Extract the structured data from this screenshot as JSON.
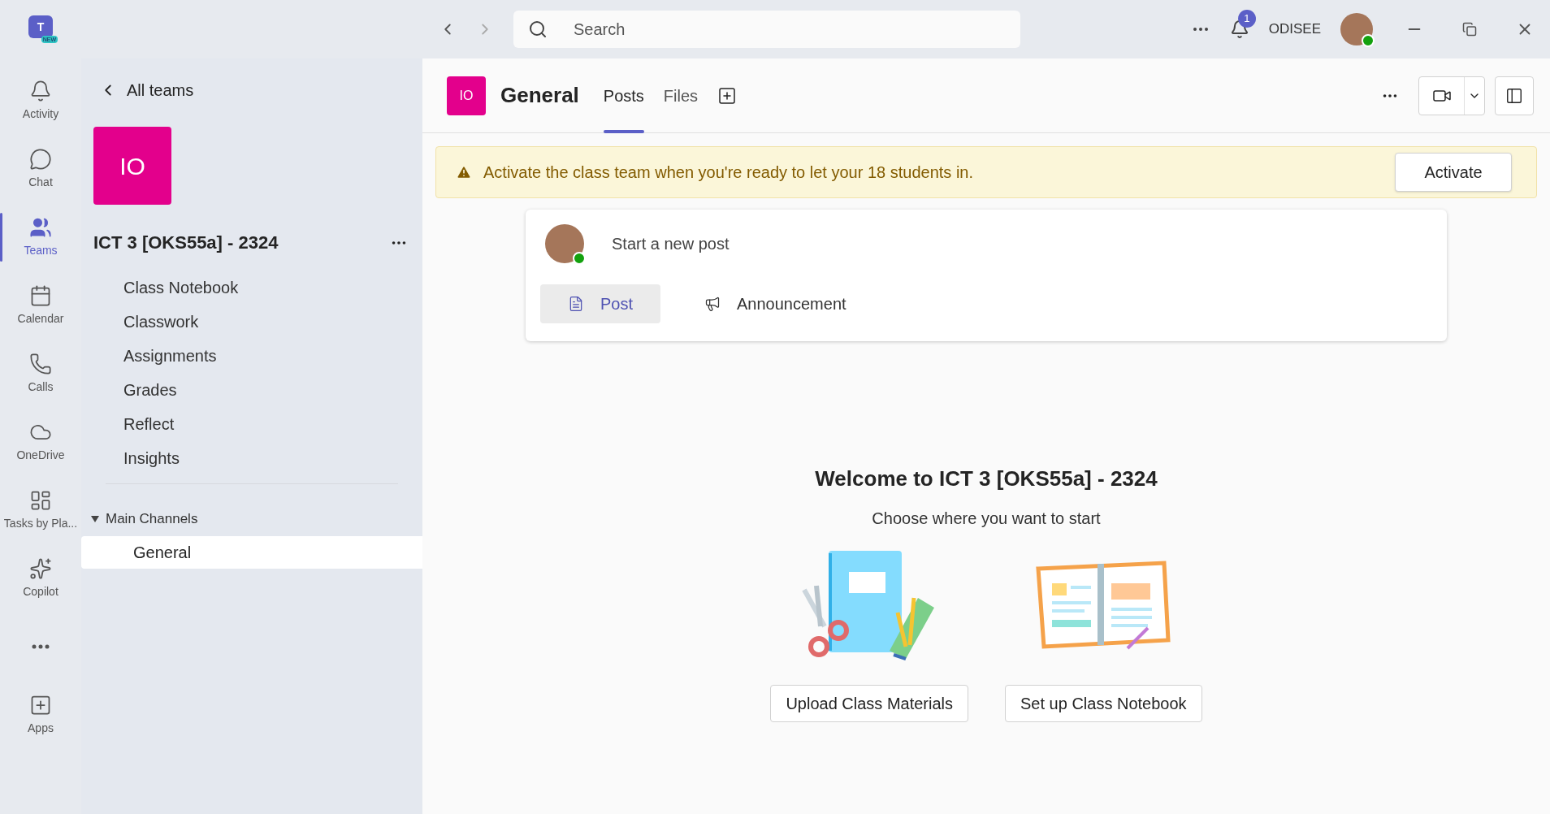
{
  "app_logo": {
    "letter": "T",
    "badge": "NEW"
  },
  "search": {
    "placeholder": "Search"
  },
  "notifications": {
    "count": "1"
  },
  "user": {
    "org": "ODISEE"
  },
  "rail": [
    {
      "label": "Activity",
      "selected": false
    },
    {
      "label": "Chat",
      "selected": false
    },
    {
      "label": "Teams",
      "selected": true
    },
    {
      "label": "Calendar",
      "selected": false
    },
    {
      "label": "Calls",
      "selected": false
    },
    {
      "label": "OneDrive",
      "selected": false
    },
    {
      "label": "Tasks by Pla...",
      "selected": false
    },
    {
      "label": "Copilot",
      "selected": false
    },
    {
      "selected": false
    },
    {
      "label": "Apps",
      "selected": false
    }
  ],
  "sidebar": {
    "back": "All teams",
    "team_initials": "IO",
    "team_name": "ICT 3 [OKS55a] - 2324",
    "items": [
      "Class Notebook",
      "Classwork",
      "Assignments",
      "Grades",
      "Reflect",
      "Insights"
    ],
    "section": {
      "label": "Main Channels",
      "expanded": true,
      "channels": [
        {
          "label": "General",
          "selected": true
        }
      ]
    }
  },
  "header": {
    "initials": "IO",
    "title": "General",
    "tabs": [
      {
        "label": "Posts",
        "selected": true
      },
      {
        "label": "Files",
        "selected": false
      }
    ]
  },
  "banner": {
    "message": "Activate the class team when you're ready to let your 18 students in.",
    "button": "Activate"
  },
  "composer": {
    "placeholder": "Start a new post",
    "actions": [
      {
        "label": "Post",
        "selected": true
      },
      {
        "label": "Announcement",
        "selected": false
      }
    ]
  },
  "welcome": {
    "title": "Welcome to ICT 3 [OKS55a] - 2324",
    "subtitle": "Choose where you want to start",
    "options": [
      {
        "label": "Upload Class Materials"
      },
      {
        "label": "Set up Class Notebook"
      }
    ]
  }
}
